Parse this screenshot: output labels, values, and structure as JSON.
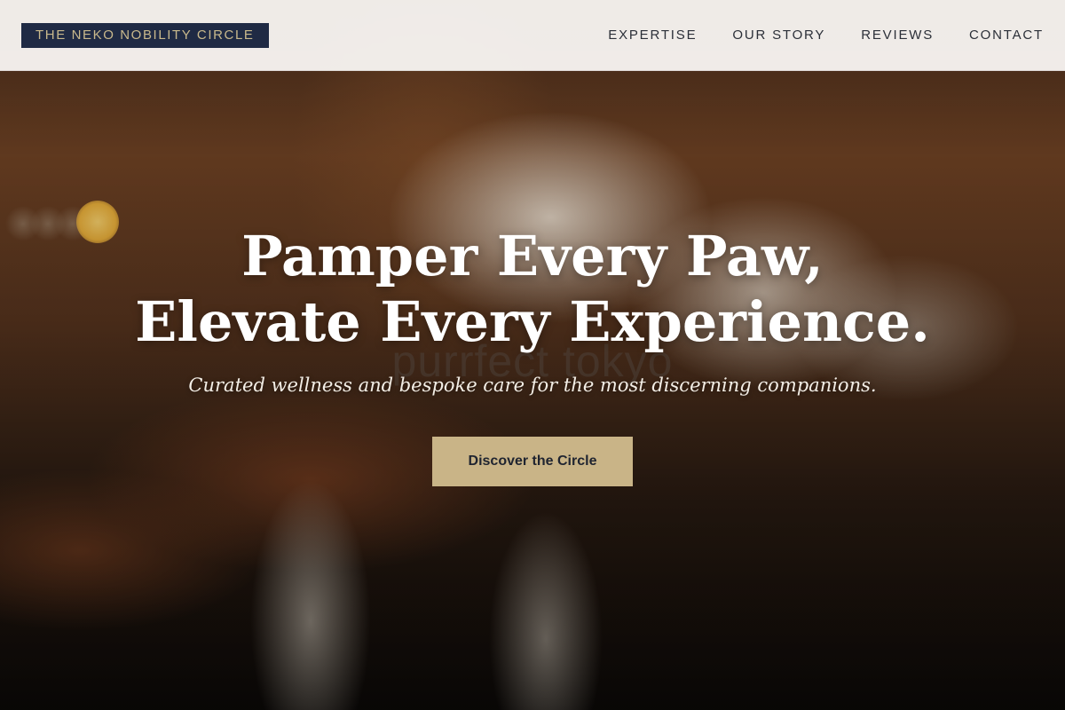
{
  "brand": {
    "name": "THE NEKO NOBILITY CIRCLE"
  },
  "nav": {
    "items": [
      {
        "label": "EXPERTISE"
      },
      {
        "label": "OUR STORY"
      },
      {
        "label": "REVIEWS"
      },
      {
        "label": "CONTACT"
      }
    ]
  },
  "hero": {
    "image": "cat-being-petted-photo",
    "headline_line1": "Pamper Every Paw,",
    "headline_line2": "Elevate Every Experience.",
    "watermark": "purrfect tokyo",
    "subheadline": "Curated wellness and bespoke care for the most discerning companions.",
    "cta_label": "Discover the Circle"
  },
  "colors": {
    "brand_bg": "#1f2a44",
    "brand_text": "#c9b98c",
    "cta_bg": "#c9b487",
    "nav_text": "#2b2f38"
  }
}
